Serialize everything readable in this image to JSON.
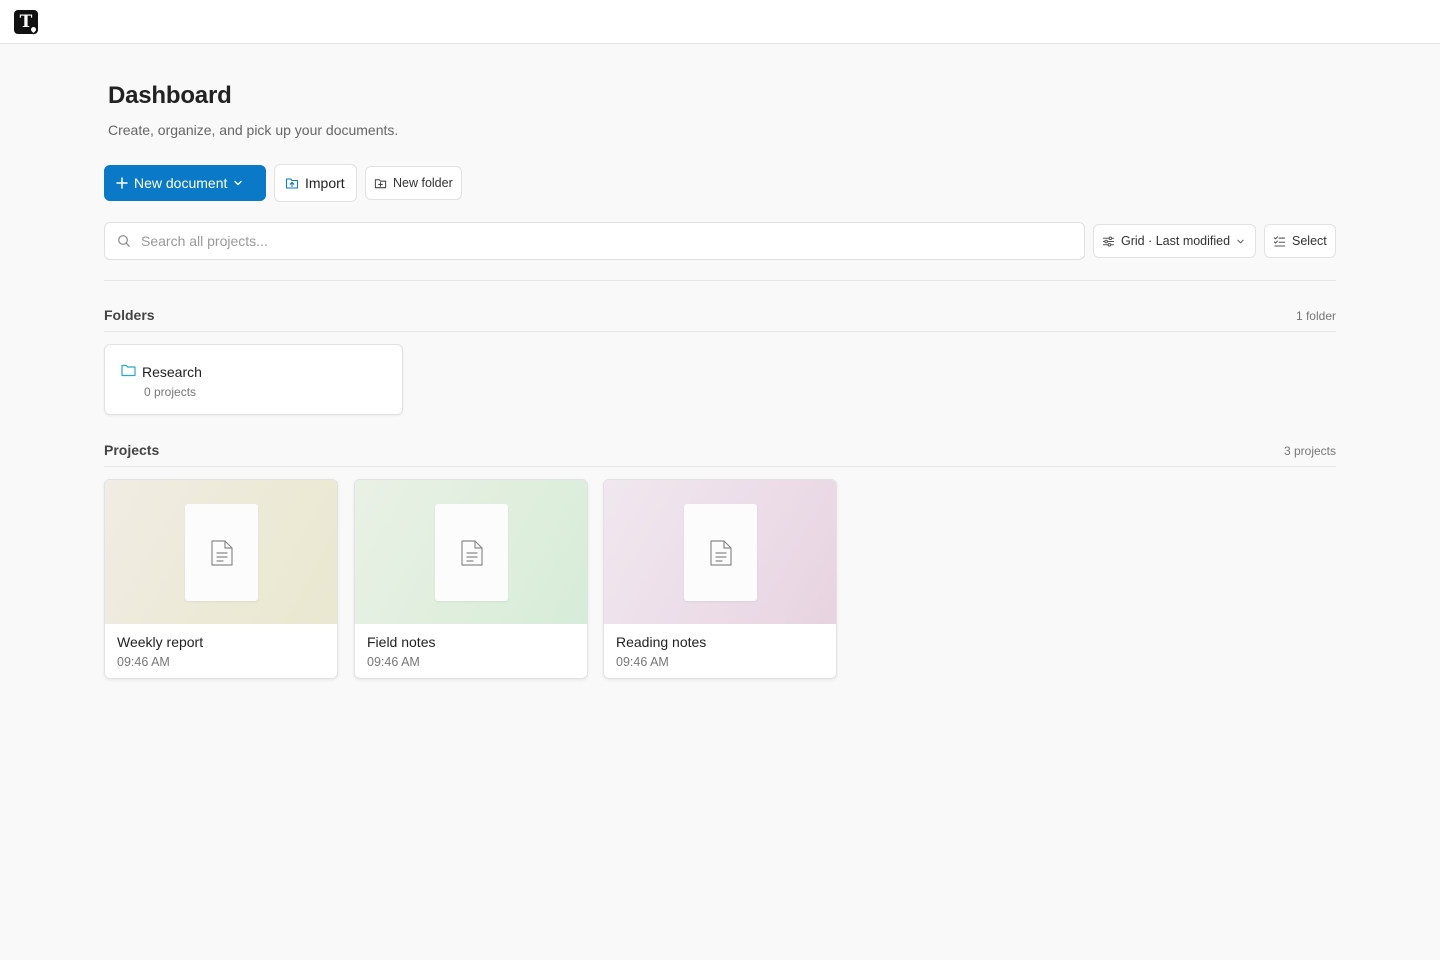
{
  "app": {
    "logo_letter": "T"
  },
  "header": {
    "title": "Dashboard",
    "subtitle": "Create, organize, and pick up your documents."
  },
  "toolbar": {
    "new_document_label": "New document",
    "import_label": "Import",
    "new_folder_label": "New folder"
  },
  "search": {
    "placeholder": "Search all projects...",
    "value": ""
  },
  "view": {
    "label": "Grid · Last modified",
    "select_label": "Select"
  },
  "folders": {
    "title": "Folders",
    "count": "1 folder",
    "items": [
      {
        "name": "Research",
        "meta": "0 projects"
      }
    ]
  },
  "projects": {
    "title": "Projects",
    "count": "3 projects",
    "items": [
      {
        "name": "Weekly report",
        "time": "09:46 AM"
      },
      {
        "name": "Field notes",
        "time": "09:46 AM"
      },
      {
        "name": "Reading notes",
        "time": "09:46 AM"
      }
    ]
  },
  "colors": {
    "accent": "#0a79c7",
    "folder_icon": "#27a9c9",
    "background": "#f9f9f9"
  },
  "icons": {
    "new_document": "plus-icon",
    "dropdown": "chevron-down-icon",
    "import": "upload-icon",
    "new_folder": "folder-plus-icon",
    "search": "search-icon",
    "view": "sliders-icon",
    "select": "checklist-icon",
    "folder": "folder-icon",
    "document": "document-icon"
  }
}
